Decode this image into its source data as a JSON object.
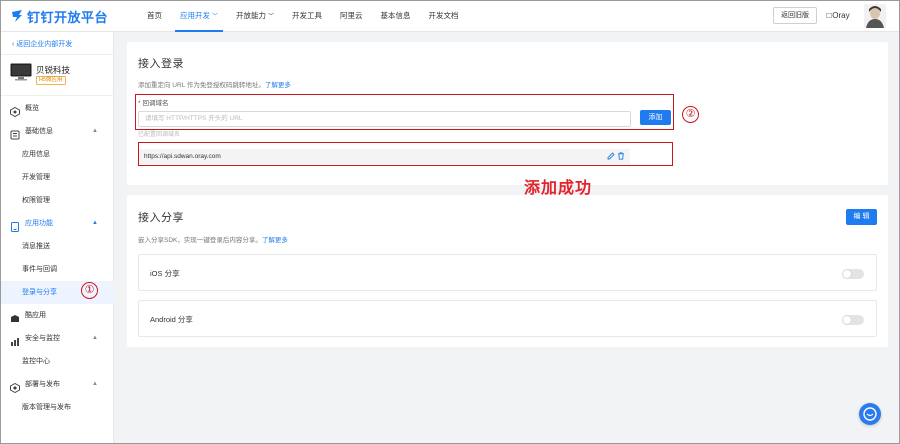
{
  "header": {
    "logo_text": "钉钉开放平台",
    "nav": [
      {
        "label": "首页",
        "active": false,
        "dropdown": false
      },
      {
        "label": "应用开发",
        "active": true,
        "dropdown": true
      },
      {
        "label": "开放能力",
        "active": false,
        "dropdown": true
      },
      {
        "label": "开发工具",
        "active": false,
        "dropdown": false
      },
      {
        "label": "阿里云",
        "active": false,
        "dropdown": false
      },
      {
        "label": "基本信息",
        "active": false,
        "dropdown": false
      },
      {
        "label": "开发文档",
        "active": false,
        "dropdown": false
      }
    ],
    "old_version_label": "返回旧版",
    "user_name": "Oray"
  },
  "sidebar": {
    "back_label": "返回企业内部开发",
    "app_name": "贝锐科技",
    "app_badge": "H5微应用",
    "menu": [
      {
        "label": "概览",
        "icon": "overview-icon",
        "type": "top",
        "arrow": ""
      },
      {
        "label": "基础信息",
        "icon": "info-icon",
        "type": "top",
        "arrow": "▲"
      },
      {
        "label": "应用信息",
        "type": "sub"
      },
      {
        "label": "开发管理",
        "type": "sub"
      },
      {
        "label": "权限管理",
        "type": "sub"
      },
      {
        "label": "应用功能",
        "icon": "app-function-icon",
        "type": "top",
        "arrow": "▲",
        "open": true
      },
      {
        "label": "消息推送",
        "type": "sub"
      },
      {
        "label": "事件与回调",
        "type": "sub"
      },
      {
        "label": "登录与分享",
        "type": "sub",
        "selected": true
      },
      {
        "label": "酷应用",
        "icon": "cool-app-icon",
        "type": "top",
        "arrow": ""
      },
      {
        "label": "安全与监控",
        "icon": "security-icon",
        "type": "top",
        "arrow": "▲"
      },
      {
        "label": "监控中心",
        "type": "sub"
      },
      {
        "label": "部署与发布",
        "icon": "deploy-icon",
        "type": "top",
        "arrow": "▲"
      },
      {
        "label": "版本管理与发布",
        "type": "sub"
      }
    ]
  },
  "login_card": {
    "title": "接入登录",
    "desc_prefix": "添加重定向 URL 作为免登授权码跳转地址。",
    "learn_more": "了解更多",
    "field_label": "回调域名",
    "input_placeholder": "请填写 HTTP/HTTPS 开头的 URL",
    "add_button": "添加",
    "saved_label": "已配置回调域名",
    "saved_url": "https://api.sdwan.oray.com"
  },
  "share_card": {
    "title": "接入分享",
    "desc_prefix": "嵌入分享SDK，实现一键登录后内容分享。",
    "learn_more": "了解更多",
    "edit_button": "编 辑",
    "rows": [
      {
        "label": "iOS 分享",
        "enabled": false
      },
      {
        "label": "Android 分享",
        "enabled": false
      }
    ]
  },
  "annotations": {
    "marker_1": "①",
    "marker_2": "②",
    "success_text": "添加成功"
  },
  "colors": {
    "brand_blue": "#1f7cf0",
    "annotation_red": "#c9161d"
  }
}
